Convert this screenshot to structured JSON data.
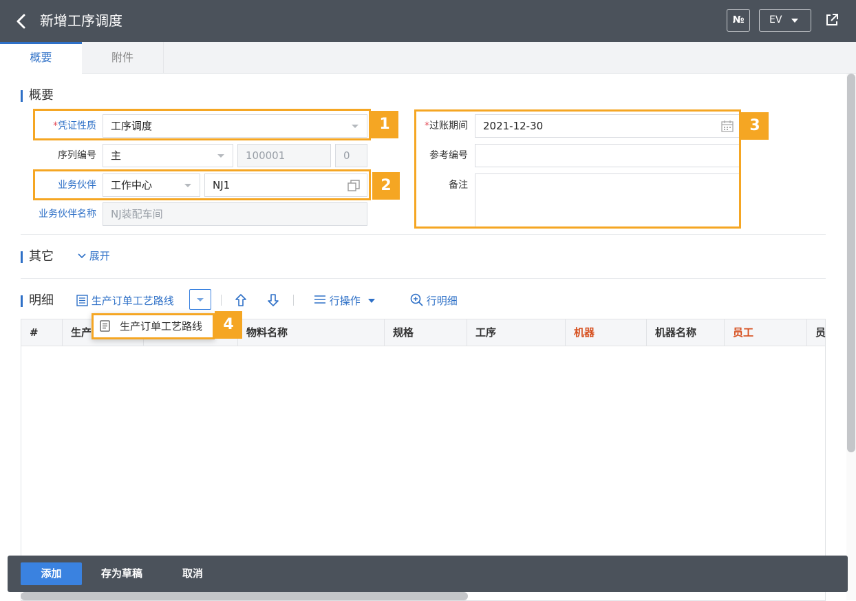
{
  "header": {
    "title": "新增工序调度",
    "no_label": "№",
    "lang_label": "EV"
  },
  "tabs": [
    {
      "label": "概要"
    },
    {
      "label": "附件"
    }
  ],
  "summary": {
    "title": "概要",
    "voucher_type": {
      "label": "凭证性质",
      "value": "工序调度"
    },
    "serial_no": {
      "label": "序列编号",
      "value": "主",
      "number": "100001",
      "suffix": "0"
    },
    "partner": {
      "label": "业务伙伴",
      "type": "工作中心",
      "code": "NJ1"
    },
    "partner_name": {
      "label": "业务伙伴名称",
      "value": "NJ装配车间"
    },
    "posting_period": {
      "label": "过账期间",
      "value": "2021-12-30"
    },
    "reference_no": {
      "label": "参考编号",
      "value": ""
    },
    "remark": {
      "label": "备注",
      "value": ""
    }
  },
  "other": {
    "title": "其它",
    "expand_label": "展开"
  },
  "detail": {
    "title": "明细",
    "routing_button": "生产订单工艺路线",
    "row_ops": "行操作",
    "row_detail": "行明细",
    "columns": [
      "#",
      "生产",
      "",
      "物料名称",
      "规格",
      "工序",
      "机器",
      "机器名称",
      "员工",
      "员"
    ],
    "menu_item": "生产订单工艺路线"
  },
  "callouts": [
    "1",
    "2",
    "3",
    "4"
  ],
  "footer": {
    "add": "添加",
    "save_draft": "存为草稿",
    "cancel": "取消"
  },
  "colors": {
    "topbar": "#4b525b",
    "accent": "#2e70c7",
    "highlight": "#f5a623",
    "required": "#e34d59",
    "machine_header": "#d6501f"
  }
}
